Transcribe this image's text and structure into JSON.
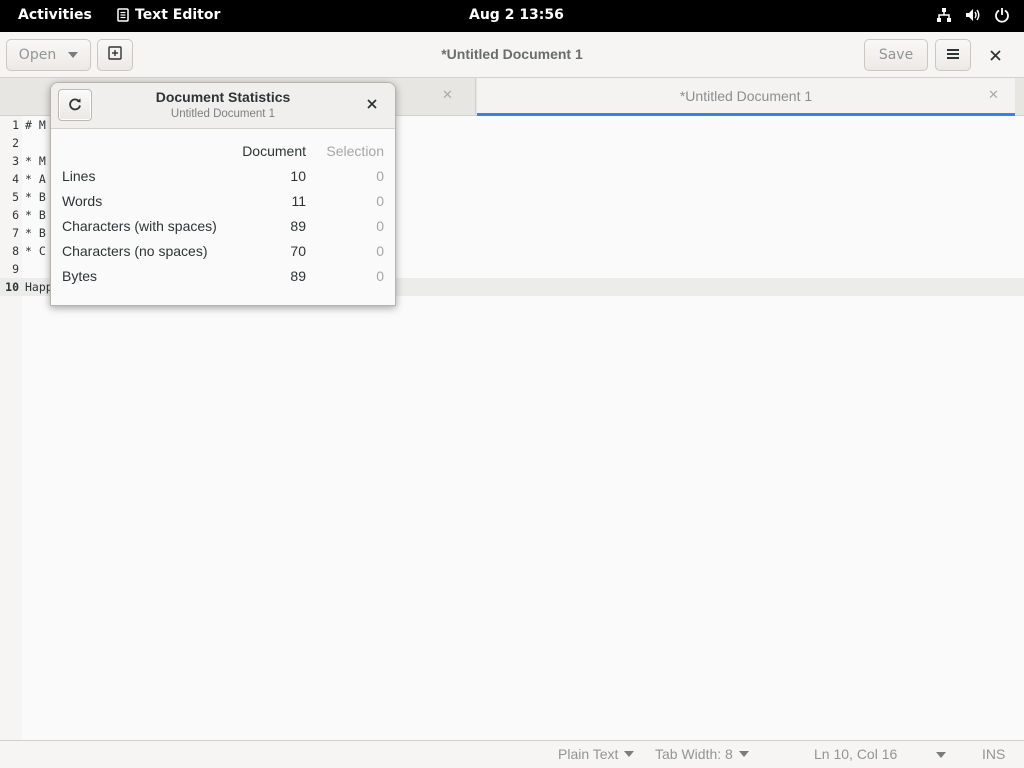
{
  "topbar": {
    "activities": "Activities",
    "app_name": "Text Editor",
    "clock": "Aug 2  13:56"
  },
  "header": {
    "open_label": "Open",
    "title": "*Untitled Document 1",
    "save_label": "Save"
  },
  "tabs": [
    {
      "label": ""
    },
    {
      "label": "*Untitled Document 1"
    }
  ],
  "editor": {
    "lines": [
      {
        "num": "1",
        "text": "# M"
      },
      {
        "num": "2",
        "text": ""
      },
      {
        "num": "3",
        "text": "* M"
      },
      {
        "num": "4",
        "text": "* A"
      },
      {
        "num": "5",
        "text": "* B"
      },
      {
        "num": "6",
        "text": "* B"
      },
      {
        "num": "7",
        "text": "* B"
      },
      {
        "num": "8",
        "text": "* C"
      },
      {
        "num": "9",
        "text": ""
      },
      {
        "num": "10",
        "text": "Happ"
      }
    ],
    "current_line": 10
  },
  "dialog": {
    "title": "Document Statistics",
    "subtitle": "Untitled Document 1",
    "col_document": "Document",
    "col_selection": "Selection",
    "rows": [
      {
        "label": "Lines",
        "document": "10",
        "selection": "0"
      },
      {
        "label": "Words",
        "document": "11",
        "selection": "0"
      },
      {
        "label": "Characters (with spaces)",
        "document": "89",
        "selection": "0"
      },
      {
        "label": "Characters (no spaces)",
        "document": "70",
        "selection": "0"
      },
      {
        "label": "Bytes",
        "document": "89",
        "selection": "0"
      }
    ]
  },
  "statusbar": {
    "language": "Plain Text",
    "tab_width": "Tab Width: 8",
    "position": "Ln 10, Col 16",
    "mode": "INS"
  },
  "icons": {
    "app": "text-editor-icon",
    "network": "network-icon",
    "volume": "volume-icon",
    "power": "power-icon",
    "new_tab": "new-tab-icon",
    "menu": "hamburger-menu-icon",
    "refresh": "refresh-icon",
    "close": "close-icon"
  },
  "colors": {
    "accent": "#3584e4",
    "topbar": "#000000"
  }
}
